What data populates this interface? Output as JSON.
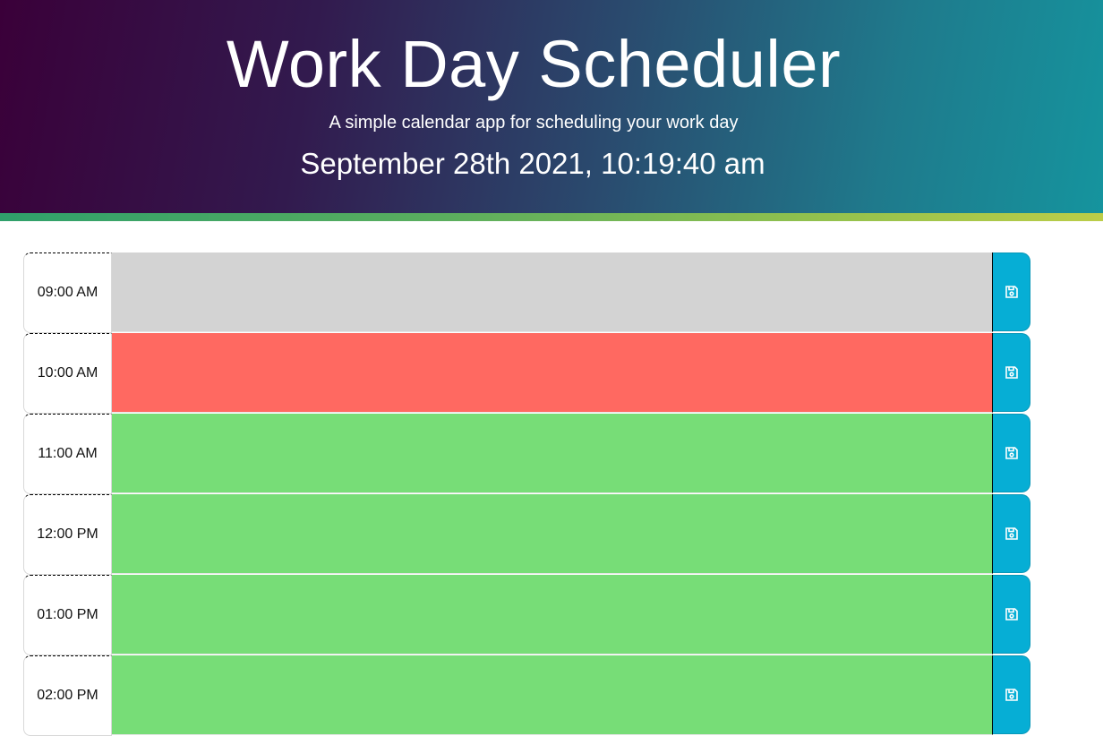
{
  "header": {
    "title": "Work Day Scheduler",
    "subtitle": "A simple calendar app for scheduling your work day",
    "current_datetime": "September 28th 2021, 10:19:40 am"
  },
  "colors": {
    "past": "#d3d3d3",
    "present": "#ff6961",
    "future": "#77dd77",
    "save_button": "#06aed5"
  },
  "time_blocks": [
    {
      "hour": "09:00 AM",
      "status": "past",
      "text": ""
    },
    {
      "hour": "10:00 AM",
      "status": "present",
      "text": ""
    },
    {
      "hour": "11:00 AM",
      "status": "future",
      "text": ""
    },
    {
      "hour": "12:00 PM",
      "status": "future",
      "text": ""
    },
    {
      "hour": "01:00 PM",
      "status": "future",
      "text": ""
    },
    {
      "hour": "02:00 PM",
      "status": "future",
      "text": ""
    }
  ],
  "icons": {
    "save": "floppy-disk-icon"
  }
}
